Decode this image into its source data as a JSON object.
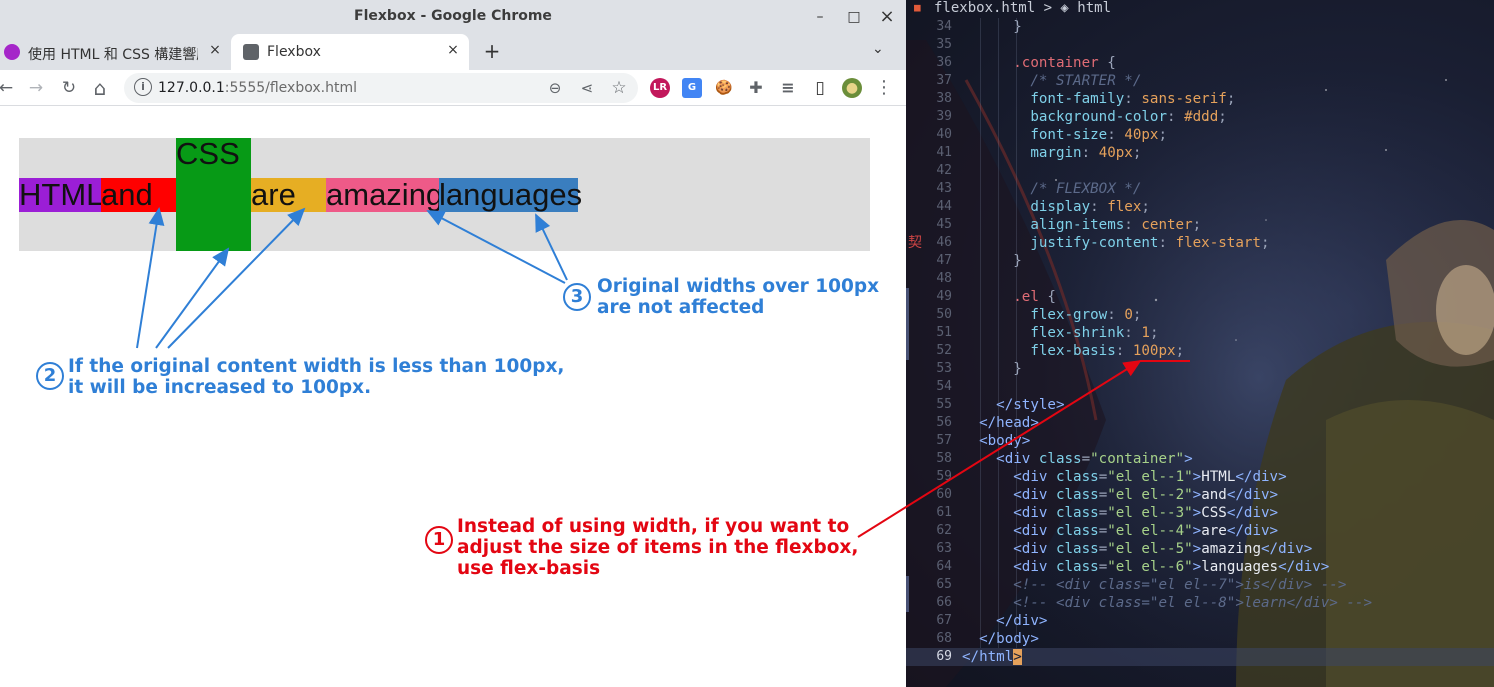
{
  "window": {
    "title": "Flexbox - Google Chrome",
    "minimize": "–",
    "maximize": "□",
    "close": "×"
  },
  "tabs": [
    {
      "label": "使用 HTML 和 CSS 構建響應",
      "close": "×"
    },
    {
      "label": "Flexbox",
      "close": "×"
    }
  ],
  "newtab": "+",
  "tabmenu": "⌄",
  "toolbar": {
    "back": "←",
    "forward": "→",
    "reload": "↻",
    "home": "⌂",
    "info": "i",
    "url_host": "127.0.0.1",
    "url_rest": ":5555/flexbox.html",
    "zoom": "⊖",
    "share": "⋖",
    "star": "☆",
    "ext": [
      "LR",
      "G",
      "🍪",
      "✚",
      "≡",
      "▯",
      "●"
    ],
    "menu": "⋮"
  },
  "page": {
    "items": [
      "HTML",
      "and",
      "CSS",
      "are",
      "amazing",
      "languages"
    ],
    "note1": {
      "num": "1",
      "lines": [
        "Instead of using width, if you want to",
        "adjust the size of items in the flexbox,",
        "use flex-basis"
      ]
    },
    "note2": {
      "num": "2",
      "lines": [
        "If the original content width is less than 100px,",
        "it will be increased to 100px."
      ]
    },
    "note3": {
      "num": "3",
      "lines": [
        "Original widths over 100px",
        "are not affected"
      ]
    }
  },
  "colors": {
    "el1": "#9b1ed6",
    "el2": "#ff0000",
    "el3": "#079a16",
    "el4": "#e6ae23",
    "el5": "#ee5a88",
    "el6": "#3a7ebf",
    "container": "#dddddd",
    "note_blue": "#2f7fd6",
    "note_red": "#e30612"
  },
  "editor": {
    "breadcrumb": "flexbox.html > ◈ html",
    "kanji": "契",
    "lines": [
      {
        "n": "34",
        "t": [
          [
            "pun",
            "      }"
          ]
        ]
      },
      {
        "n": "35",
        "t": []
      },
      {
        "n": "36",
        "t": [
          [
            "sel",
            "      .container"
          ],
          [
            "pun",
            " {"
          ]
        ]
      },
      {
        "n": "37",
        "t": [
          [
            "cm",
            "        /* STARTER */"
          ]
        ]
      },
      {
        "n": "38",
        "t": [
          [
            "prop",
            "        font-family"
          ],
          [
            "pun",
            ": "
          ],
          [
            "val",
            "sans-serif"
          ],
          [
            "pun",
            ";"
          ]
        ]
      },
      {
        "n": "39",
        "t": [
          [
            "prop",
            "        background-color"
          ],
          [
            "pun",
            ": "
          ],
          [
            "val",
            "#ddd"
          ],
          [
            "pun",
            ";"
          ]
        ]
      },
      {
        "n": "40",
        "t": [
          [
            "prop",
            "        font-size"
          ],
          [
            "pun",
            ": "
          ],
          [
            "val",
            "40px"
          ],
          [
            "pun",
            ";"
          ]
        ]
      },
      {
        "n": "41",
        "t": [
          [
            "prop",
            "        margin"
          ],
          [
            "pun",
            ": "
          ],
          [
            "val",
            "40px"
          ],
          [
            "pun",
            ";"
          ]
        ]
      },
      {
        "n": "42",
        "t": []
      },
      {
        "n": "43",
        "t": [
          [
            "cm",
            "        /* FLEXBOX */"
          ]
        ]
      },
      {
        "n": "44",
        "t": [
          [
            "prop",
            "        display"
          ],
          [
            "pun",
            ": "
          ],
          [
            "val",
            "flex"
          ],
          [
            "pun",
            ";"
          ]
        ]
      },
      {
        "n": "45",
        "t": [
          [
            "prop",
            "        align-items"
          ],
          [
            "pun",
            ": "
          ],
          [
            "val",
            "center"
          ],
          [
            "pun",
            ";"
          ]
        ]
      },
      {
        "n": "46",
        "t": [
          [
            "prop",
            "        justify-content"
          ],
          [
            "pun",
            ": "
          ],
          [
            "val",
            "flex-start"
          ],
          [
            "pun",
            ";"
          ]
        ]
      },
      {
        "n": "47",
        "t": [
          [
            "pun",
            "      }"
          ]
        ]
      },
      {
        "n": "48",
        "t": []
      },
      {
        "n": "49",
        "t": [
          [
            "sel",
            "      .el"
          ],
          [
            "pun",
            " {"
          ]
        ]
      },
      {
        "n": "50",
        "t": [
          [
            "prop",
            "        flex-grow"
          ],
          [
            "pun",
            ": "
          ],
          [
            "val",
            "0"
          ],
          [
            "pun",
            ";"
          ]
        ]
      },
      {
        "n": "51",
        "t": [
          [
            "prop",
            "        flex-shrink"
          ],
          [
            "pun",
            ": "
          ],
          [
            "val",
            "1"
          ],
          [
            "pun",
            ";"
          ]
        ]
      },
      {
        "n": "52",
        "t": [
          [
            "prop",
            "        flex-basis"
          ],
          [
            "pun",
            ": "
          ],
          [
            "val",
            "100px"
          ],
          [
            "pun",
            ";"
          ]
        ]
      },
      {
        "n": "53",
        "t": [
          [
            "pun",
            "      }"
          ]
        ]
      },
      {
        "n": "54",
        "t": []
      },
      {
        "n": "55",
        "t": [
          [
            "tag",
            "    </style>"
          ]
        ]
      },
      {
        "n": "56",
        "t": [
          [
            "tag",
            "  </head>"
          ]
        ]
      },
      {
        "n": "57",
        "t": [
          [
            "tag",
            "  <body>"
          ]
        ]
      },
      {
        "n": "58",
        "t": [
          [
            "tag",
            "    <div "
          ],
          [
            "attr",
            "class"
          ],
          [
            "pun",
            "="
          ],
          [
            "str",
            "\"container\""
          ],
          [
            "tag",
            ">"
          ]
        ]
      },
      {
        "n": "59",
        "t": [
          [
            "tag",
            "      <div "
          ],
          [
            "attr",
            "class"
          ],
          [
            "pun",
            "="
          ],
          [
            "str",
            "\"el el--1\""
          ],
          [
            "tag",
            ">"
          ],
          [
            "plain",
            "HTML"
          ],
          [
            "tag",
            "</div>"
          ]
        ]
      },
      {
        "n": "60",
        "t": [
          [
            "tag",
            "      <div "
          ],
          [
            "attr",
            "class"
          ],
          [
            "pun",
            "="
          ],
          [
            "str",
            "\"el el--2\""
          ],
          [
            "tag",
            ">"
          ],
          [
            "plain",
            "and"
          ],
          [
            "tag",
            "</div>"
          ]
        ]
      },
      {
        "n": "61",
        "t": [
          [
            "tag",
            "      <div "
          ],
          [
            "attr",
            "class"
          ],
          [
            "pun",
            "="
          ],
          [
            "str",
            "\"el el--3\""
          ],
          [
            "tag",
            ">"
          ],
          [
            "plain",
            "CSS"
          ],
          [
            "tag",
            "</div>"
          ]
        ]
      },
      {
        "n": "62",
        "t": [
          [
            "tag",
            "      <div "
          ],
          [
            "attr",
            "class"
          ],
          [
            "pun",
            "="
          ],
          [
            "str",
            "\"el el--4\""
          ],
          [
            "tag",
            ">"
          ],
          [
            "plain",
            "are"
          ],
          [
            "tag",
            "</div>"
          ]
        ]
      },
      {
        "n": "63",
        "t": [
          [
            "tag",
            "      <div "
          ],
          [
            "attr",
            "class"
          ],
          [
            "pun",
            "="
          ],
          [
            "str",
            "\"el el--5\""
          ],
          [
            "tag",
            ">"
          ],
          [
            "plain",
            "amazing"
          ],
          [
            "tag",
            "</div>"
          ]
        ]
      },
      {
        "n": "64",
        "t": [
          [
            "tag",
            "      <div "
          ],
          [
            "attr",
            "class"
          ],
          [
            "pun",
            "="
          ],
          [
            "str",
            "\"el el--6\""
          ],
          [
            "tag",
            ">"
          ],
          [
            "plain",
            "languages"
          ],
          [
            "tag",
            "</div>"
          ]
        ]
      },
      {
        "n": "65",
        "t": [
          [
            "cm",
            "      <!-- <div class=\"el el--7\">is</div> -->"
          ]
        ]
      },
      {
        "n": "66",
        "t": [
          [
            "cm",
            "      <!-- <div class=\"el el--8\">learn</div> -->"
          ]
        ]
      },
      {
        "n": "67",
        "t": [
          [
            "tag",
            "    </div>"
          ]
        ]
      },
      {
        "n": "68",
        "t": [
          [
            "tag",
            "  </body>"
          ]
        ]
      },
      {
        "n": "69",
        "t": [
          [
            "tag",
            "</html"
          ],
          [
            "hi",
            ">"
          ]
        ]
      }
    ]
  }
}
